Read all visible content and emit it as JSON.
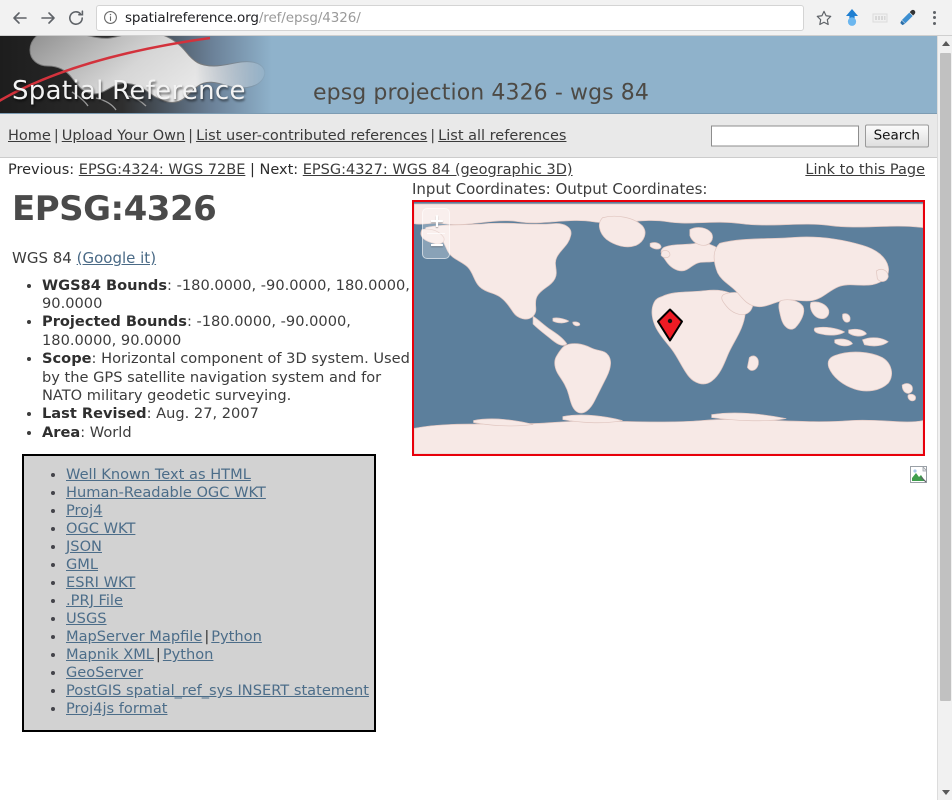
{
  "browser": {
    "back_label": "Back",
    "forward_label": "Forward",
    "reload_label": "Reload",
    "url_domain": "spatialreference.org",
    "url_path": "/ref/epsg/4326/",
    "info_icon": "info-circle-icon",
    "star_icon": "bookmark-star-icon",
    "extension_icon": "extension-icon",
    "second_extension_icon": "extension-icon-disabled",
    "eyedropper_icon": "eyedropper-icon",
    "menu_icon": "three-dot-menu-icon"
  },
  "banner": {
    "logo_text": "Spatial Reference",
    "page_title": "epsg projection 4326 - wgs 84",
    "background_color": "#8fb2cb",
    "arc_color": "#d3323c"
  },
  "nav": {
    "items": [
      {
        "label": "Home"
      },
      {
        "label": "Upload Your Own"
      },
      {
        "label": "List user-contributed references"
      },
      {
        "label": "List all references"
      }
    ],
    "separator": "|",
    "search": {
      "value": "",
      "placeholder": "",
      "button_label": "Search"
    }
  },
  "prevnext": {
    "previous_label": "Previous:",
    "previous_link": "EPSG:4324: WGS 72BE",
    "separator": "|",
    "next_label": "Next:",
    "next_link": "EPSG:4327: WGS 84 (geographic 3D)",
    "link_to_page": "Link to this Page"
  },
  "main": {
    "title": "EPSG:4326",
    "subtitle_name": "WGS 84",
    "google_it": "(Google it)",
    "facts": [
      {
        "label": "WGS84 Bounds",
        "value": ": -180.0000, -90.0000, 180.0000, 90.0000"
      },
      {
        "label": "Projected Bounds",
        "value": ": -180.0000, -90.0000, 180.0000, 90.0000"
      },
      {
        "label": "Scope",
        "value": ": Horizontal component of 3D system. Used by the GPS satellite navigation system and for NATO military geodetic surveying."
      },
      {
        "label": "Last Revised",
        "value": ": Aug. 27, 2007"
      },
      {
        "label": "Area",
        "value": ": World"
      }
    ]
  },
  "links_box": {
    "items": [
      {
        "text": "Well Known Text as HTML"
      },
      {
        "text": "Human-Readable OGC WKT"
      },
      {
        "text": "Proj4"
      },
      {
        "text": "OGC WKT"
      },
      {
        "text": "JSON"
      },
      {
        "text": "GML"
      },
      {
        "text": "ESRI WKT"
      },
      {
        "text": ".PRJ File"
      },
      {
        "text": "USGS"
      },
      {
        "text": "MapServer Mapfile",
        "extra": "Python"
      },
      {
        "text": "Mapnik XML",
        "extra": "Python"
      },
      {
        "text": "GeoServer"
      },
      {
        "text": "PostGIS spatial_ref_sys INSERT statement"
      },
      {
        "text": "Proj4js format"
      }
    ],
    "pipe": "|",
    "background_color": "#d2d2d2"
  },
  "map": {
    "coords_label": "Input Coordinates: Output Coordinates:",
    "zoom_in_label": "+",
    "zoom_out_label": "−",
    "border_color": "#e8000b",
    "ocean_color": "#5c7f9c",
    "land_color": "#f7e9e6",
    "marker_color": "#ee1b24",
    "marker_name": "map-marker-pin",
    "broken_image_alt": "broken-image"
  },
  "scrollbar": {
    "up_label": "scroll up",
    "down_label": "scroll down"
  }
}
